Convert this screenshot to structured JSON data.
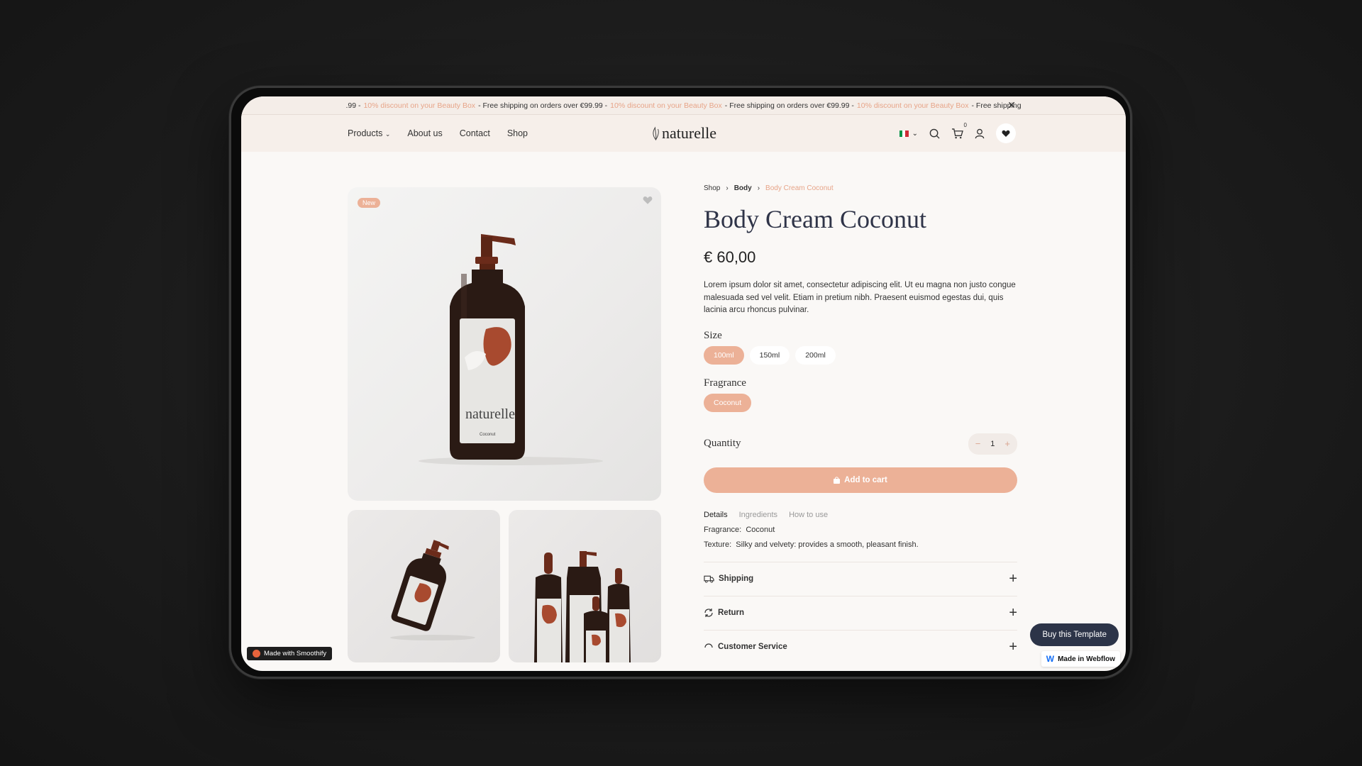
{
  "announcement": {
    "segments": [
      {
        "text": ".99 - ",
        "accent": false
      },
      {
        "text": "10% discount on your Beauty Box",
        "accent": true
      },
      {
        "text": " - Free shipping on orders over €99.99 - ",
        "accent": false
      },
      {
        "text": "10% discount on your Beauty Box",
        "accent": true
      },
      {
        "text": " - Free shipping on orders over €99.99 - ",
        "accent": false
      },
      {
        "text": "10% discount on your Beauty Box",
        "accent": true
      },
      {
        "text": " - Free shipping",
        "accent": false
      }
    ],
    "close_icon": "close-icon"
  },
  "nav": {
    "products": "Products",
    "about": "About us",
    "contact": "Contact",
    "shop": "Shop",
    "logo": "naturelle",
    "cart_count": "0",
    "flag_colors": [
      "#009246",
      "#ffffff",
      "#ce2b37"
    ]
  },
  "gallery": {
    "badge": "New",
    "bottle_label": "naturelle",
    "bottle_sub": "Coconut"
  },
  "product": {
    "breadcrumb": {
      "shop": "Shop",
      "body": "Body",
      "current": "Body Cream Coconut"
    },
    "title": "Body Cream Coconut",
    "price": "€ 60,00",
    "description": "Lorem ipsum dolor sit amet, consectetur adipiscing elit. Ut eu magna non justo congue malesuada sed vel velit. Etiam in pretium nibh. Praesent euismod egestas dui, quis lacinia arcu rhoncus pulvinar.",
    "size_label": "Size",
    "sizes": [
      "100ml",
      "150ml",
      "200ml"
    ],
    "fragrance_label": "Fragrance",
    "fragrances": [
      "Coconut"
    ],
    "quantity_label": "Quantity",
    "quantity": "1",
    "minus": "−",
    "plus": "+",
    "add_to_cart": "Add to cart",
    "tabs": [
      "Details",
      "Ingredients",
      "How to use"
    ],
    "details": {
      "fragrance_key": "Fragrance:",
      "fragrance_val": "Coconut",
      "texture_key": "Texture:",
      "texture_val": "Silky and velvety: provides a smooth, pleasant finish."
    },
    "accordions": {
      "shipping": "Shipping",
      "return": "Return",
      "customer_service": "Customer Service"
    }
  },
  "overlays": {
    "smoothify": "Made with Smoothify",
    "buy_template": "Buy this Template",
    "webflow": "Made in Webflow"
  },
  "colors": {
    "accent": "#ecb197",
    "title": "#2f3448",
    "bottle_cap": "#6b2b1a"
  }
}
